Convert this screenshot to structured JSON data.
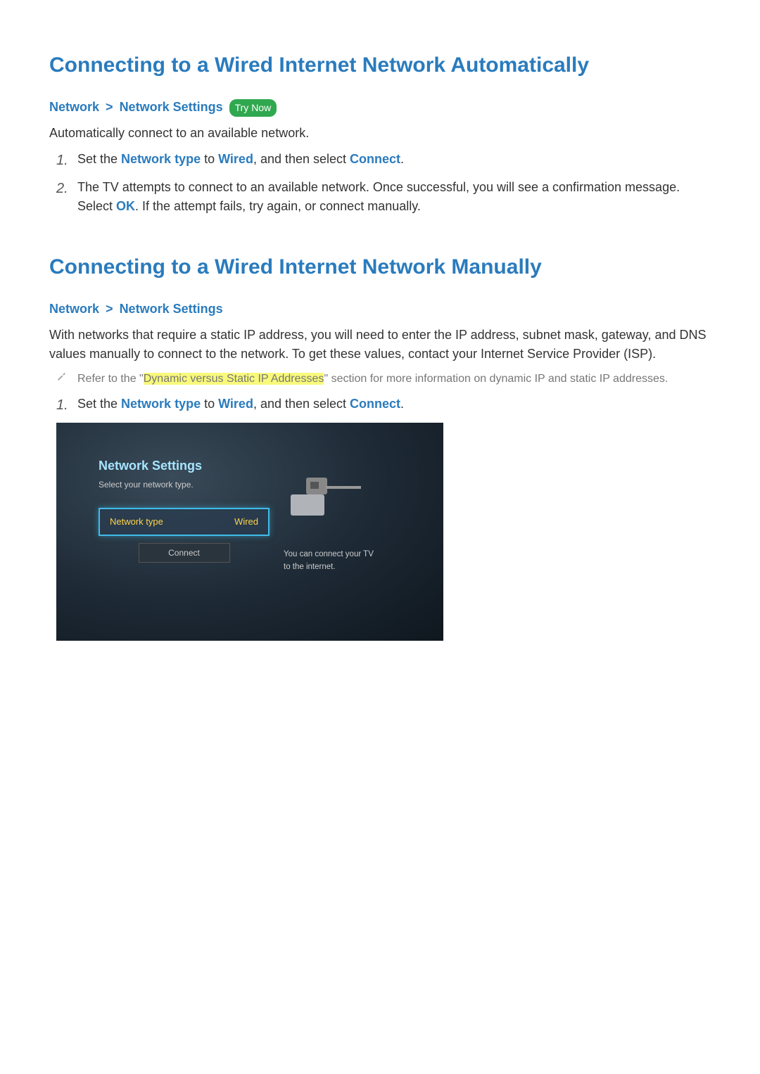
{
  "section1": {
    "title": "Connecting to a Wired Internet Network Automatically",
    "breadcrumb": {
      "a": "Network",
      "sep": ">",
      "b": "Network Settings",
      "try_now": "Try Now"
    },
    "intro": "Automatically connect to an available network.",
    "steps": [
      {
        "num": "1.",
        "pre": "Set the ",
        "kw1": "Network type",
        "mid": " to ",
        "kw2": "Wired",
        "mid2": ", and then select ",
        "kw3": "Connect",
        "post": "."
      },
      {
        "num": "2.",
        "pre": "The TV attempts to connect to an available network. Once successful, you will see a confirmation message. Select ",
        "kw1": "OK",
        "post": ". If the attempt fails, try again, or connect manually."
      }
    ]
  },
  "section2": {
    "title": "Connecting to a Wired Internet Network Manually",
    "breadcrumb": {
      "a": "Network",
      "sep": ">",
      "b": "Network Settings"
    },
    "intro": "With networks that require a static IP address, you will need to enter the IP address, subnet mask, gateway, and DNS values manually to connect to the network. To get these values, contact your Internet Service Provider (ISP).",
    "note": {
      "pre": "Refer to the \"",
      "hl": "Dynamic versus Static IP Addresses",
      "post": "\" section for more information on dynamic IP and static IP addresses."
    },
    "step1": {
      "num": "1.",
      "pre": "Set the ",
      "kw1": "Network type",
      "mid": " to ",
      "kw2": "Wired",
      "mid2": ", and then select ",
      "kw3": "Connect",
      "post": "."
    }
  },
  "tv": {
    "title": "Network Settings",
    "sub": "Select your network type.",
    "row_label": "Network type",
    "row_value": "Wired",
    "connect": "Connect",
    "hint1": "You can connect your TV",
    "hint2": "to the internet."
  }
}
